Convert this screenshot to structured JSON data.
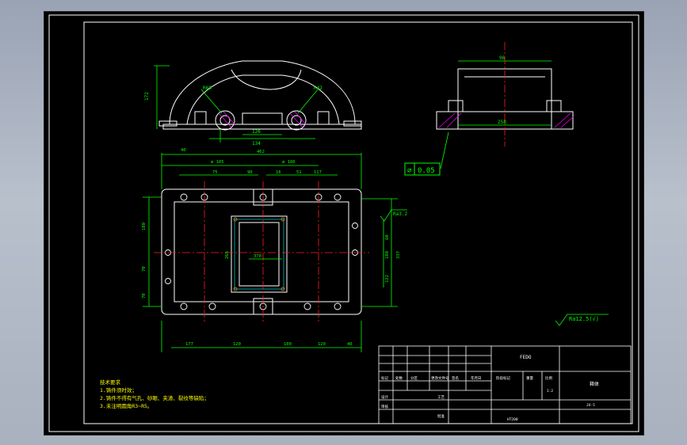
{
  "drawing": {
    "tolerance": {
      "symbol": "⌀",
      "value": "0.05"
    },
    "roughness_main": "Ra3.2",
    "roughness_general": "Ra12.5(√)",
    "title_block": {
      "company": "FEDO",
      "part_name": "箱体",
      "drawing_no": "JX-5",
      "material": "HT200",
      "scale": "1:2",
      "row_labels": [
        "标记",
        "设计",
        "审核",
        "工艺",
        "批准"
      ],
      "header_cells": [
        "处数",
        "分区",
        "更改文件号",
        "签名",
        "年月日"
      ],
      "mid_labels": [
        "阶段标记",
        "重量",
        "比例"
      ]
    },
    "notes": {
      "title": "技术要求",
      "lines": [
        "1.铸件须时效；",
        "2.铸件不得有气孔、砂眼、夹渣、裂纹等缺陷；",
        "3.未注明圆角R3~R5。"
      ]
    },
    "dims_top": [
      "172",
      "126",
      "134",
      "R68",
      "R42"
    ],
    "dims_plan_top": [
      "462",
      "ø 105",
      "ø 106",
      "75",
      "90",
      "16",
      "51",
      "117",
      "40"
    ],
    "dims_plan_bottom": [
      "177",
      "120",
      "100",
      "120",
      "40"
    ],
    "dims_plan_left": [
      "180",
      "70",
      "70"
    ],
    "dims_plan_right": [
      "337",
      "180",
      "122",
      "60",
      "265",
      "370"
    ],
    "dims_side": [
      "96",
      "258"
    ]
  },
  "colors": {
    "line_white": "#ffffff",
    "dim_green": "#00ff00",
    "center_red": "#ff2020",
    "hatch_magenta": "#ff00ff",
    "note_yellow": "#ffff00",
    "hole_orange": "#ff8000",
    "accent_cyan": "#00ffff"
  }
}
